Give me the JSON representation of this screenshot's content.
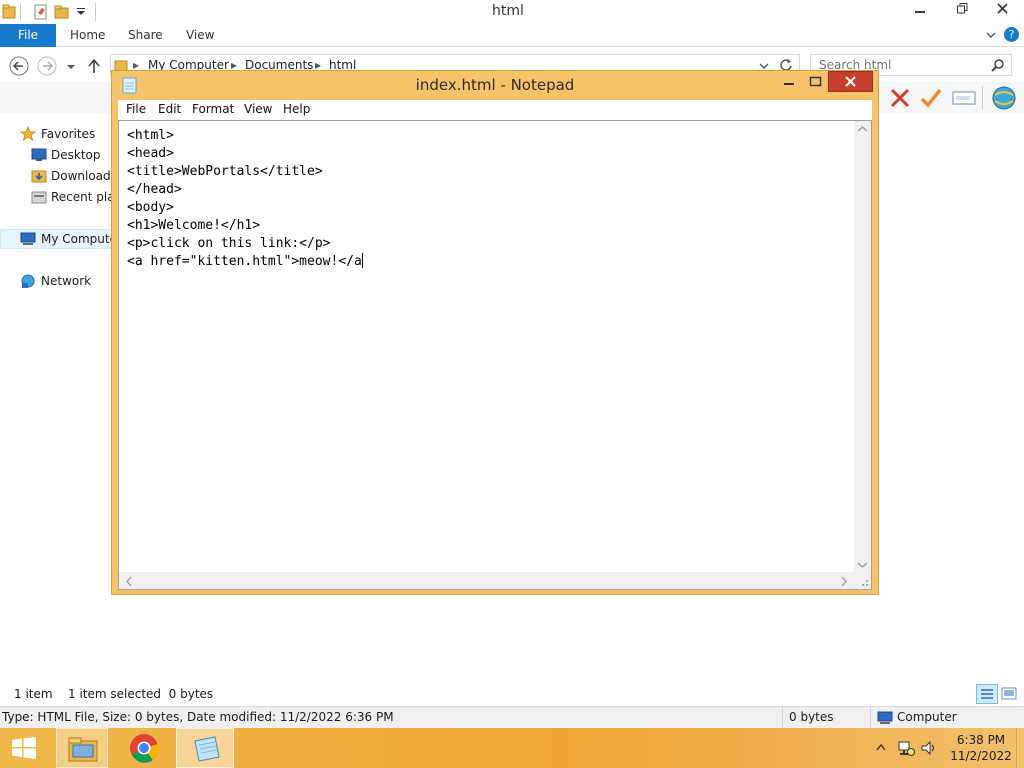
{
  "explorer": {
    "title": "html",
    "ribbon": {
      "file_tab": "File",
      "tabs": [
        "Home",
        "Share",
        "View"
      ]
    },
    "address": {
      "crumbs": [
        "My Computer",
        "Documents",
        "html"
      ]
    },
    "search": {
      "placeholder": "Search html"
    },
    "navpane": {
      "items": [
        {
          "label": "Favorites",
          "icon": "star-icon"
        },
        {
          "label": "Desktop",
          "icon": "desktop-icon"
        },
        {
          "label": "Downloads",
          "icon": "downloads-folder-icon"
        },
        {
          "label": "Recent places",
          "icon": "recent-places-icon"
        },
        {
          "label": "My Computer",
          "icon": "computer-icon"
        },
        {
          "label": "Network",
          "icon": "network-icon"
        }
      ]
    },
    "status": {
      "item_count": "1 item",
      "selection": "1 item selected  0 bytes"
    },
    "details": {
      "info": "Type: HTML File, Size: 0 bytes, Date modified: 11/2/2022 6:36 PM",
      "size": "0 bytes",
      "location": "Computer"
    }
  },
  "notepad": {
    "title": "index.html - Notepad",
    "menu": [
      "File",
      "Edit",
      "Format",
      "View",
      "Help"
    ],
    "content": "<html>\n<head>\n<title>WebPortals</title>\n</head>\n<body>\n<h1>Welcome!</h1>\n<p>click on this link:</p>\n<a href=\"kitten.html\">meow!</a"
  },
  "taskbar": {
    "time": "6:38 PM",
    "date": "11/2/2022"
  },
  "colors": {
    "accent_file_tab": "#1979ca",
    "notepad_frame": "#f6c36b",
    "close_button": "#c7402f",
    "taskbar": "#efa335"
  }
}
